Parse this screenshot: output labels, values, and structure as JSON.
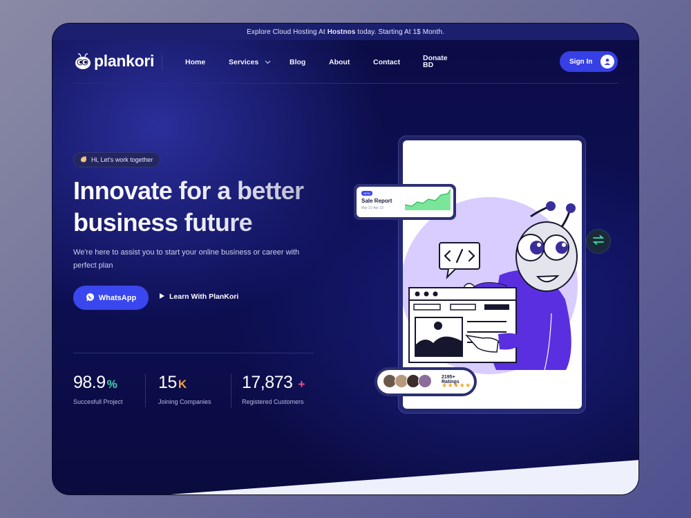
{
  "promo": {
    "prefix": "Explore Cloud Hosting At",
    "brand": "Hostnos",
    "suffix": "today. Starting At 1$ Month."
  },
  "nav": {
    "logo": "plankori",
    "items": [
      {
        "label": "Home"
      },
      {
        "label": "Services"
      },
      {
        "label": "Blog"
      },
      {
        "label": "About"
      },
      {
        "label": "Contact"
      },
      {
        "label": "Donate BD"
      }
    ],
    "signin": "Sign In"
  },
  "hero": {
    "pill": "Hi, Let's work together",
    "headline": "Innovate for a better business future",
    "subtitle": "We're here to assist you to start your online business or career with perfect plan",
    "cta_primary": "WhatsApp",
    "cta_secondary": "Learn With PlanKori"
  },
  "stats": [
    {
      "value": "98.9",
      "suffix": "%",
      "suffix_color": "#41d6b4",
      "label": "Succesfull Project"
    },
    {
      "value": "15",
      "suffix": "K",
      "suffix_color": "#f7a53a",
      "label": "Joining Companies"
    },
    {
      "value": "17,873",
      "suffix": "+",
      "suffix_color": "#ff4f8b",
      "label": "Registered Customers"
    }
  ],
  "illustration": {
    "sale_report": {
      "tag": "NEW",
      "title": "Sale Report",
      "date": "Mar 21-Apr 23"
    },
    "ratings": {
      "text": "2195+ Ratings",
      "stars": "★★★★★"
    }
  },
  "colors": {
    "accent": "#3a47ee",
    "background": "#0b0c45",
    "illustration_purple": "#5a2fe0"
  }
}
